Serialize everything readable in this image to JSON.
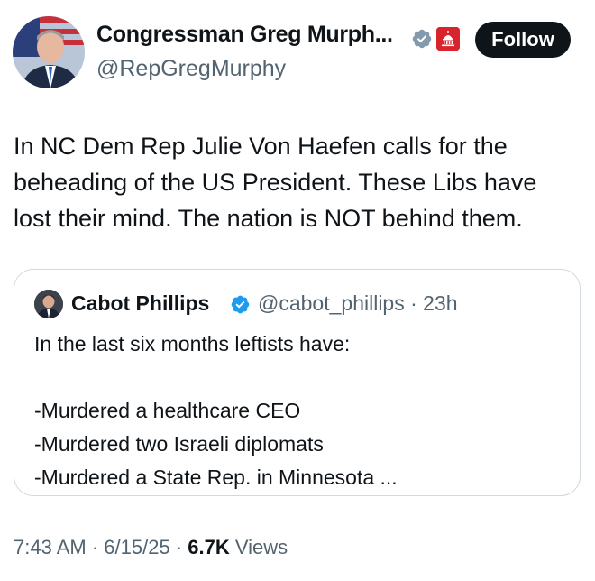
{
  "author": {
    "name": "Congressman Greg Murph...",
    "handle": "@RepGregMurphy",
    "follow_label": "Follow"
  },
  "tweet": {
    "lines": [
      "In NC Dem Rep Julie Von Haefen calls for the",
      "beheading of the US President. These Libs have",
      "lost their mind. The nation is NOT behind them."
    ]
  },
  "quote": {
    "name": "Cabot Phillips",
    "handle_time": "@cabot_phillips · 23h",
    "lines": [
      "In the last six months leftists have:",
      "",
      "-Murdered a healthcare CEO",
      "-Murdered two Israeli diplomats",
      "-Murdered a State Rep. in Minnesota ..."
    ]
  },
  "meta": {
    "time": "7:43 AM",
    "date": "6/15/25",
    "views_count": "6.7K",
    "views_label": "Views"
  },
  "colors": {
    "verified_blue": "#1d9bf0",
    "verified_grey": "#829aab",
    "gov_badge_red": "#d8242c",
    "follow_bg": "#0f1419"
  },
  "icons": {
    "author_verified": "verified-grey-badge-icon",
    "author_affiliate": "capitol-badge-icon",
    "quote_verified": "verified-blue-badge-icon"
  }
}
